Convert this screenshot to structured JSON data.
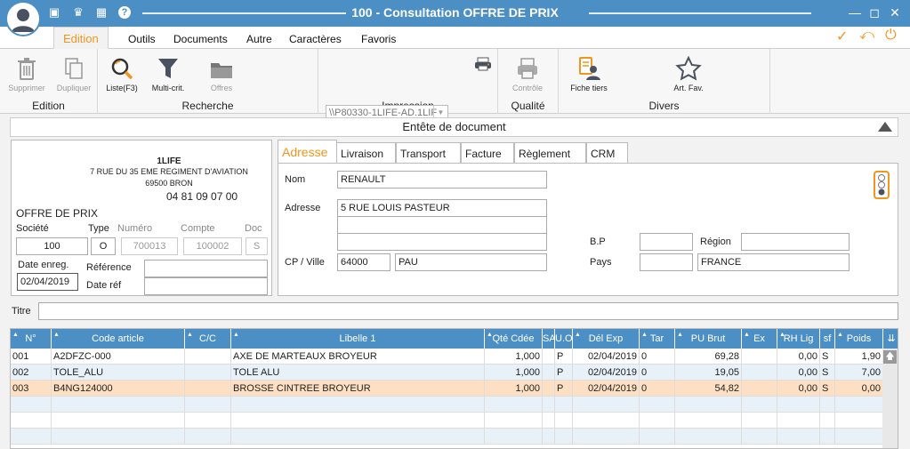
{
  "window": {
    "title": "100 - Consultation OFFRE DE PRIX",
    "colors": {
      "accent": "#4b8fc4",
      "orange": "#f0961e",
      "selected_row": "#fde0c4"
    }
  },
  "menu": {
    "items": [
      "Edition",
      "Outils",
      "Documents",
      "Autre",
      "Caractères",
      "Favoris"
    ],
    "active": "Edition"
  },
  "ribbon": {
    "edition": {
      "label": "Edition",
      "delete": "Supprimer",
      "duplicate": "Dupliquer"
    },
    "recherche": {
      "label": "Recherche",
      "list": "Liste(F3)",
      "multi": "Multi-crit.",
      "offres": "Offres"
    },
    "impression": {
      "label": "Impression",
      "printer": "\\\\P80330-1LIFE-AD.1LIF"
    },
    "qualite": {
      "label": "Qualité",
      "controle": "Contrôle"
    },
    "divers": {
      "label": "Divers",
      "fiche": "Fiche tiers",
      "fav": "Art. Fav."
    }
  },
  "section": {
    "title": "Entête de document"
  },
  "company": {
    "name": "1LIFE",
    "address": "7 RUE DU 35 EME REGIMENT D'AVIATION",
    "city": "69500 BRON",
    "phone": "04 81 09 07 00",
    "doc_type": "OFFRE DE PRIX"
  },
  "doc": {
    "labels": {
      "societe": "Société",
      "type": "Type",
      "numero": "Numéro",
      "compte": "Compte",
      "doc": "Doc",
      "date_enreg": "Date enreg.",
      "reference": "Référence",
      "date_ref": "Date réf"
    },
    "societe": "100",
    "type": "O",
    "numero": "700013",
    "compte": "100002",
    "doc": "S",
    "date_enreg": "02/04/2019",
    "reference": "",
    "date_ref": ""
  },
  "tabs": [
    "Adresse",
    "Livraison",
    "Transport",
    "Facture",
    "Règlement",
    "CRM"
  ],
  "address": {
    "labels": {
      "nom": "Nom",
      "adresse": "Adresse",
      "cp_ville": "CP / Ville",
      "bp": "B.P",
      "pays": "Pays",
      "region": "Région"
    },
    "nom": "RENAULT",
    "line1": "5 RUE LOUIS PASTEUR",
    "line2": "",
    "line3": "",
    "cp": "64000",
    "ville": "PAU",
    "bp": "",
    "pays_code": "",
    "region": "",
    "pays": "FRANCE"
  },
  "titre": {
    "label": "Titre",
    "value": ""
  },
  "grid": {
    "columns": [
      "N°",
      "Code article",
      "C/C",
      "Libelle 1",
      "Qté Cdée",
      "SA",
      "U.O",
      "Dél Exp",
      "Tar",
      "PU Brut",
      "Ex",
      "RH Lig",
      "sf",
      "Poids"
    ],
    "rows": [
      {
        "n": "001",
        "code": "A2DFZC-000",
        "cc": "",
        "lib": "AXE DE MARTEAUX BROYEUR",
        "qte": "1,000",
        "sa": "",
        "uo": "P",
        "del": "02/04/2019",
        "tar": "0",
        "pu": "69,28",
        "ex": "",
        "rh": "0,00",
        "sf": "S",
        "poids": "1,90"
      },
      {
        "n": "002",
        "code": "TOLE_ALU",
        "cc": "",
        "lib": "TOLE ALU",
        "qte": "1,000",
        "sa": "",
        "uo": "P",
        "del": "02/04/2019",
        "tar": "0",
        "pu": "19,05",
        "ex": "",
        "rh": "0,00",
        "sf": "S",
        "poids": "7,00"
      },
      {
        "n": "003",
        "code": "B4NG124000",
        "cc": "",
        "lib": "BROSSE CINTREE BROYEUR",
        "qte": "1,000",
        "sa": "",
        "uo": "P",
        "del": "02/04/2019",
        "tar": "0",
        "pu": "54,82",
        "ex": "",
        "rh": "0,00",
        "sf": "S",
        "poids": "0,00"
      }
    ],
    "selected_index": 2
  }
}
